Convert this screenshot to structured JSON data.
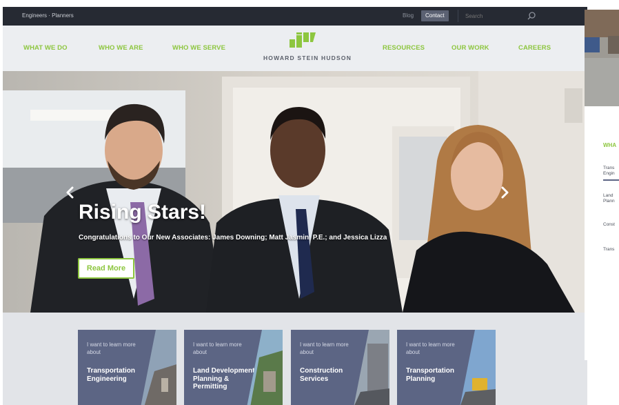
{
  "topbar": {
    "tagline": "Engineers · Planners",
    "blog": "Blog",
    "contact": "Contact",
    "search_placeholder": "Search",
    "search_icon": "search-icon"
  },
  "nav": {
    "left": [
      "WHAT WE DO",
      "WHO WE ARE",
      "WHO WE SERVE"
    ],
    "right": [
      "RESOURCES",
      "OUR WORK",
      "CAREERS"
    ],
    "logo_text": "HOWARD STEIN HUDSON"
  },
  "hero": {
    "title": "Rising Stars!",
    "subtitle": "Congratulations to Our New Associates: James Downing; Matt Jasmin, P.E.; and Jessica Lizza",
    "button": "Read More",
    "prev_icon": "chevron-left-icon",
    "next_icon": "chevron-right-icon"
  },
  "cards": [
    {
      "pre": "I want to learn more about",
      "title": "Transportation Engineering"
    },
    {
      "pre": "I want to learn more about",
      "title": "Land Development Planning & Permitting"
    },
    {
      "pre": "I want to learn more about",
      "title": "Construction Services"
    },
    {
      "pre": "I want to learn more about",
      "title": "Transportation Planning"
    }
  ],
  "side_panel": {
    "heading": "WHA",
    "items": [
      "Trans",
      "Engin",
      "Land",
      "Plann",
      "Const",
      "Trans"
    ]
  },
  "colors": {
    "accent_green": "#8dc63f",
    "topbar": "#262a33",
    "card_blue": "#5c6584"
  }
}
